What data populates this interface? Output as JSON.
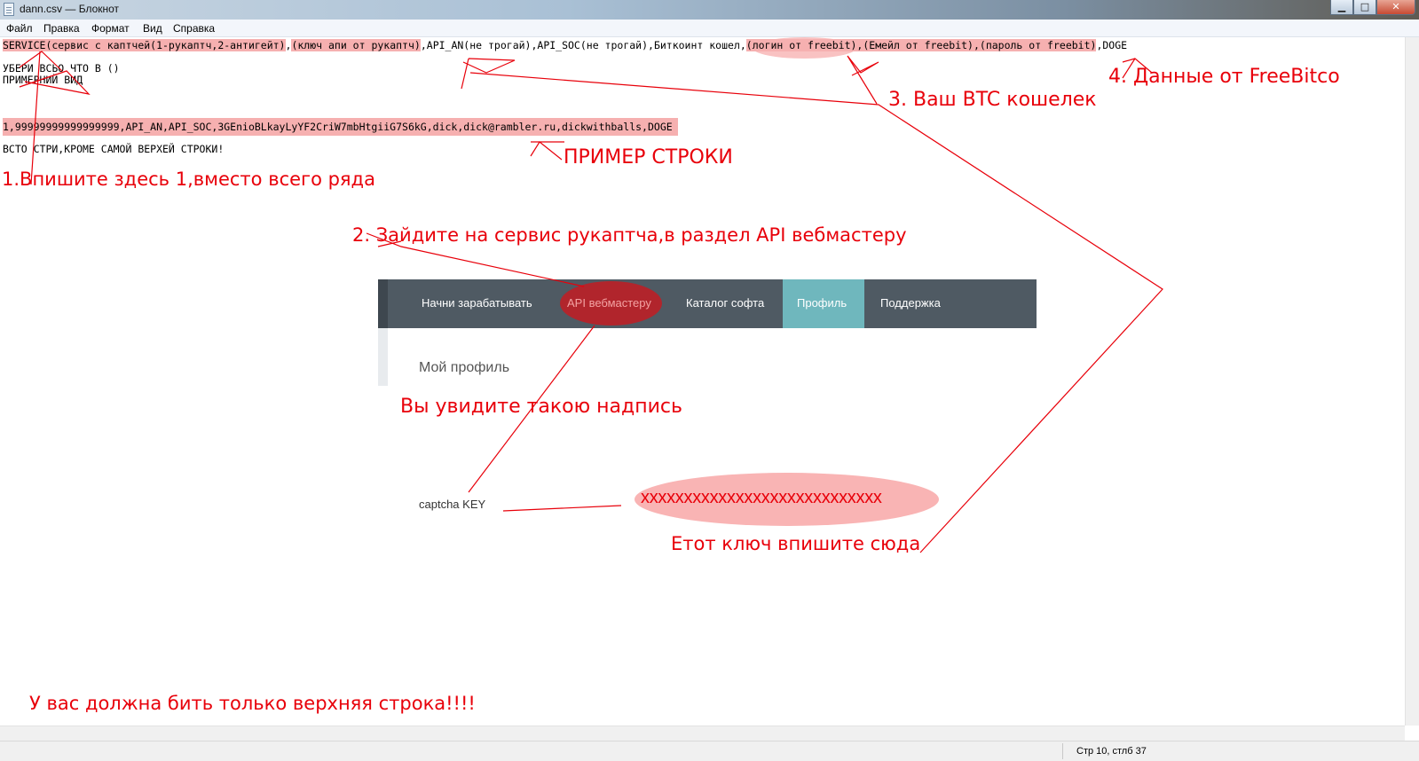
{
  "window": {
    "title": "dann.csv — Блокнот",
    "minimize_glyph": "▁",
    "maximize_glyph": "□",
    "close_glyph": "✕"
  },
  "menu": [
    "Файл",
    "Правка",
    "Формат",
    "Вид",
    "Справка"
  ],
  "text_lines": {
    "header": {
      "service": "SERVICE(сервис с каптчей(1-рукаптч,2-антигейт)",
      "comma1": ",",
      "apikey": "(ключ апи от рукаптч)",
      "mid": ",API_AN(не трогай),API_SOC(не трогай),Биткоинт кошел,",
      "freebit": "(логин от freebit),(Емейл от freebit),(пароль от freebit)",
      "tail": ",DOGE"
    },
    "line2": "УБЕРИ ВСЬО ЧТО В ()",
    "line3": "ПРИМЕРНИЙ ВИД",
    "example": "1,99999999999999999,API_AN,API_SOC,3GEnioBLkayLyYF2CriW7mbHtgiiG7S6kG,dick,dick@rambler.ru,dickwithballs,DOGE",
    "line_note": "ВСТО СТРИ,КРОМЕ САМОЙ ВЕРХЕЙ СТРОКИ!"
  },
  "annotations": {
    "a1": "1.Впишите здесь 1,вместо всего ряда",
    "a2": "2. Зайдите на сервис рукаптча,в раздел API вебмастеру",
    "a3": "3. Ваш BTC кошелек",
    "a4": "4. Данные от FreeBitco",
    "example_label": "ПРИМЕР СТРОКИ",
    "you_see": "Вы увидите такою надпись",
    "enter_key": "Етот ключ впишите сюда",
    "bottom": "У вас должна бить только верхняя строка!!!!"
  },
  "embedded_site": {
    "nav": [
      "Начни зарабатывать",
      "API вебмастеру",
      "Каталог софта",
      "Профиль",
      "Поддержка"
    ],
    "profile_title": "Мой профиль",
    "captcha_label": "captcha KEY",
    "captcha_value": "xxxxxxxxxxxxxxxxxxxxxxxxxxxx"
  },
  "status": {
    "position": "Стр 10, стлб 37"
  },
  "colors": {
    "annotation_red": "#e8000a",
    "highlight": "#f6b0b0",
    "nav_bg": "#4f5a63",
    "nav_active": "#6fb7bd",
    "nav_pill": "#b1252c"
  }
}
